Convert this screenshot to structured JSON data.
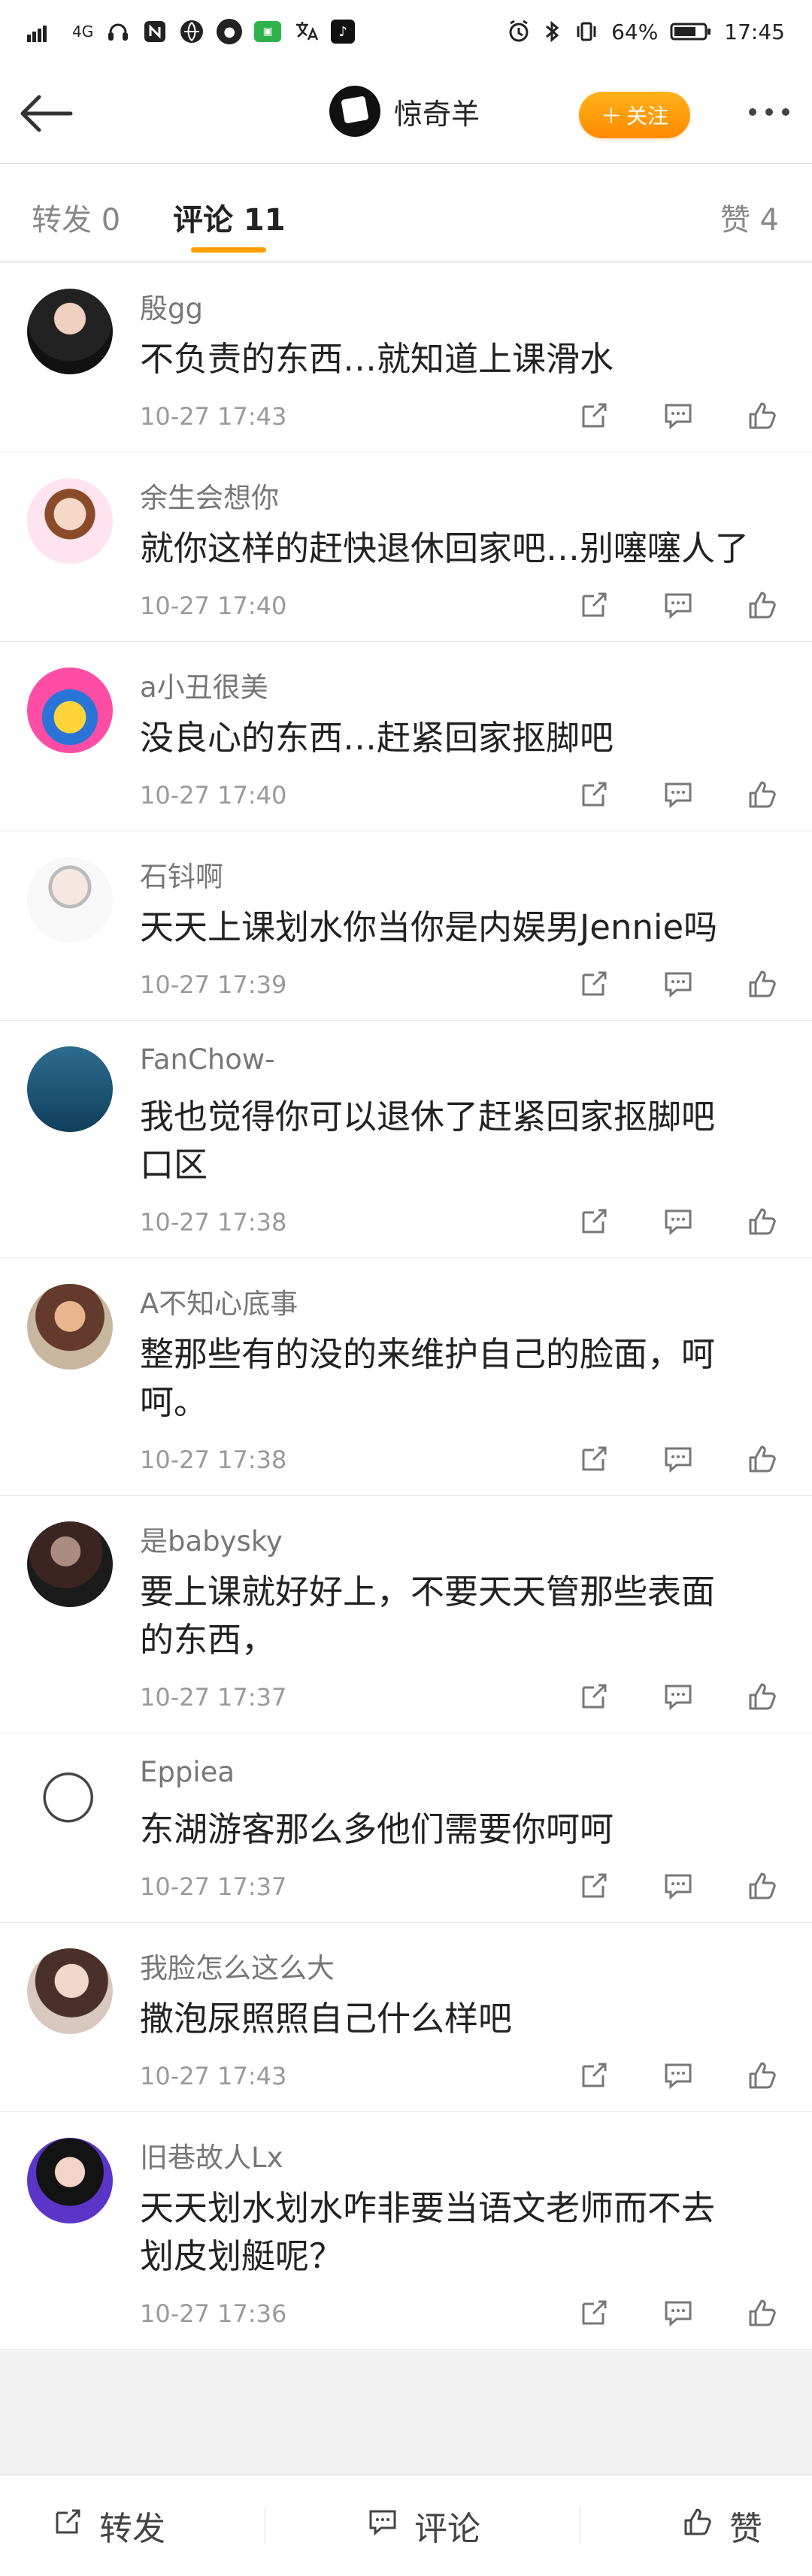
{
  "status_bar": {
    "signal_text": "4G",
    "battery": "64%",
    "time": "17:45"
  },
  "nav": {
    "username": "惊奇羊",
    "follow_label": "关注"
  },
  "tabs": [
    {
      "label": "转发 0"
    },
    {
      "label": "评论 11"
    },
    {
      "label": "赞 4"
    }
  ],
  "comments": [
    {
      "author": "殷gg",
      "text": "不负责的东西…就知道上课滑水",
      "time": "10-27 17:43"
    },
    {
      "author": "余生会想你",
      "text": "就你这样的赶快退休回家吧…别噻噻人了",
      "time": "10-27 17:40"
    },
    {
      "author": "a小丑很美",
      "text": "没良心的东西…赶紧回家抠脚吧",
      "time": "10-27 17:40"
    },
    {
      "author": "石钭啊",
      "text": "天天上课划水你当你是内娱男Jennie吗",
      "time": "10-27 17:39"
    },
    {
      "author": "FanChow-",
      "text": "我也觉得你可以退休了赶紧回家抠脚吧\n口区",
      "time": "10-27 17:38"
    },
    {
      "author": "A不知心底事",
      "text": "整那些有的没的来维护自己的脸面，呵\n呵。",
      "time": "10-27 17:38"
    },
    {
      "author": "是babysky",
      "text": "要上课就好好上，不要天天管那些表面\n的东西，",
      "time": "10-27 17:37"
    },
    {
      "author": "Eppiea",
      "text": "东湖游客那么多他们需要你呵呵",
      "time": "10-27 17:37"
    },
    {
      "author": "我脸怎么这么大",
      "text": "撒泡尿照照自己什么样吧",
      "time": "10-27 17:43"
    },
    {
      "author": "旧巷故人Lx",
      "text": "天天划水划水咋非要当语文老师而不去\n划皮划艇呢？",
      "time": "10-27 17:36"
    }
  ],
  "bottom_bar": {
    "repost": "转发",
    "comment": "评论",
    "like": "赞"
  }
}
